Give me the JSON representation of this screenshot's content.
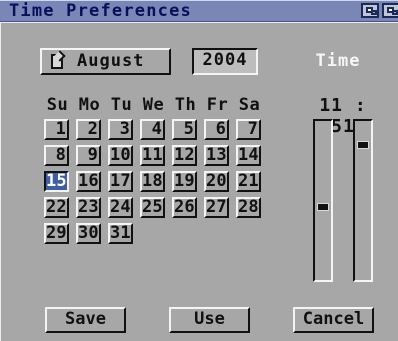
{
  "window": {
    "title": "Time Preferences"
  },
  "calendar": {
    "month": "August",
    "year": "2004",
    "weekdays": [
      "Su",
      "Mo",
      "Tu",
      "We",
      "Th",
      "Fr",
      "Sa"
    ],
    "days": [
      "1",
      "2",
      "3",
      "4",
      "5",
      "6",
      "7",
      "8",
      "9",
      "10",
      "11",
      "12",
      "13",
      "14",
      "15",
      "16",
      "17",
      "18",
      "19",
      "20",
      "21",
      "22",
      "23",
      "24",
      "25",
      "26",
      "27",
      "28",
      "29",
      "30",
      "31"
    ],
    "selected_day": "15"
  },
  "time": {
    "label": "Time",
    "hour": "11",
    "separator": ":",
    "minute": "51",
    "hour_slider_level": 0.46,
    "minute_slider_level": 0.86
  },
  "buttons": {
    "save": "Save",
    "use": "Use",
    "cancel": "Cancel"
  },
  "icons": {
    "depth_gadget": "depth-icon",
    "cycle_gadget": "cycle-icon"
  },
  "colors": {
    "titlebar": "#7a86b5",
    "title_text": "#07115b",
    "selected_day": "#3e5fa4",
    "window_bg": "#a7a7a7"
  }
}
